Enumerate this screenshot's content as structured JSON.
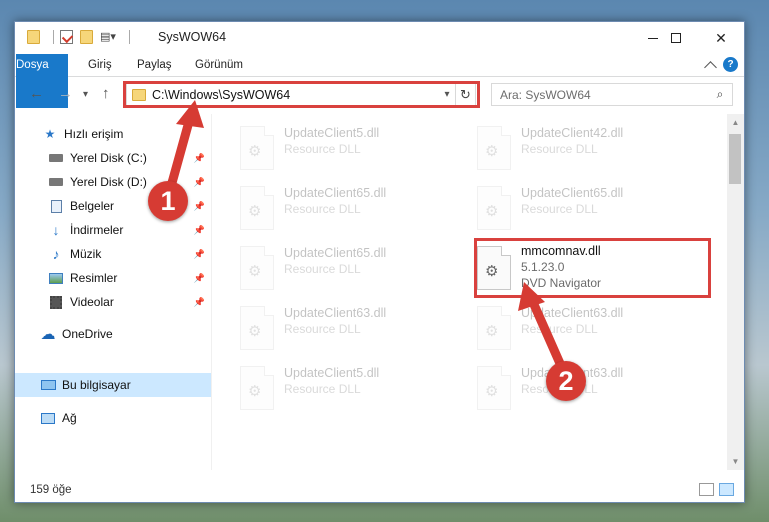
{
  "window": {
    "title": "SysWOW64",
    "controls": {
      "minimize": "minimize",
      "maximize": "maximize",
      "close": "✕"
    }
  },
  "ribbon": {
    "tabs": [
      "Dosya",
      "Giriş",
      "Paylaş",
      "Görünüm"
    ],
    "help": "?"
  },
  "nav": {
    "address": "C:\\Windows\\SysWOW64",
    "search_placeholder": "Ara: SysWOW64"
  },
  "sidebar": {
    "items": [
      {
        "label": "Hızlı erişim",
        "icon": "star-icon"
      },
      {
        "label": "Yerel Disk (C:)",
        "icon": "drive-icon",
        "pinned": true
      },
      {
        "label": "Yerel Disk (D:)",
        "icon": "drive-icon",
        "pinned": true
      },
      {
        "label": "Belgeler",
        "icon": "documents-icon",
        "pinned": true
      },
      {
        "label": "İndirmeler",
        "icon": "download-icon",
        "pinned": true
      },
      {
        "label": "Müzik",
        "icon": "music-icon",
        "pinned": true
      },
      {
        "label": "Resimler",
        "icon": "pictures-icon",
        "pinned": true
      },
      {
        "label": "Videolar",
        "icon": "videos-icon",
        "pinned": true
      },
      {
        "label": "OneDrive",
        "icon": "cloud-icon"
      },
      {
        "label": "Bu bilgisayar",
        "icon": "computer-icon",
        "selected": true
      },
      {
        "label": "Ağ",
        "icon": "network-icon"
      }
    ]
  },
  "files": [
    {
      "name": "UpdateClient5.dll",
      "type": "Resource DLL",
      "faded": true
    },
    {
      "name": "UpdateClient42.dll",
      "type": "Resource DLL",
      "faded": true
    },
    {
      "name": "UpdateClient65.dll",
      "type": "Resource DLL",
      "faded": true
    },
    {
      "name": "UpdateClient65.dll",
      "type": "Resource DLL",
      "faded": true
    },
    {
      "name": "UpdateClient65.dll",
      "type": "Resource DLL",
      "faded": true
    },
    {
      "name": "mmcomnav.dll",
      "version": "5.1.23.0",
      "type": "DVD Navigator",
      "faded": false,
      "highlighted": true
    },
    {
      "name": "UpdateClient63.dll",
      "type": "Resource DLL",
      "faded": true
    },
    {
      "name": "UpdateClient63.dll",
      "type": "Resource DLL",
      "faded": true
    },
    {
      "name": "UpdateClient5.dll",
      "type": "Resource DLL",
      "faded": true
    },
    {
      "name": "UpdateClient63.dll",
      "type": "Resource DLL",
      "faded": true
    }
  ],
  "status": {
    "item_count": "159 öğe"
  },
  "annotations": {
    "step1": "1",
    "step2": "2",
    "color": "#d63b33"
  }
}
